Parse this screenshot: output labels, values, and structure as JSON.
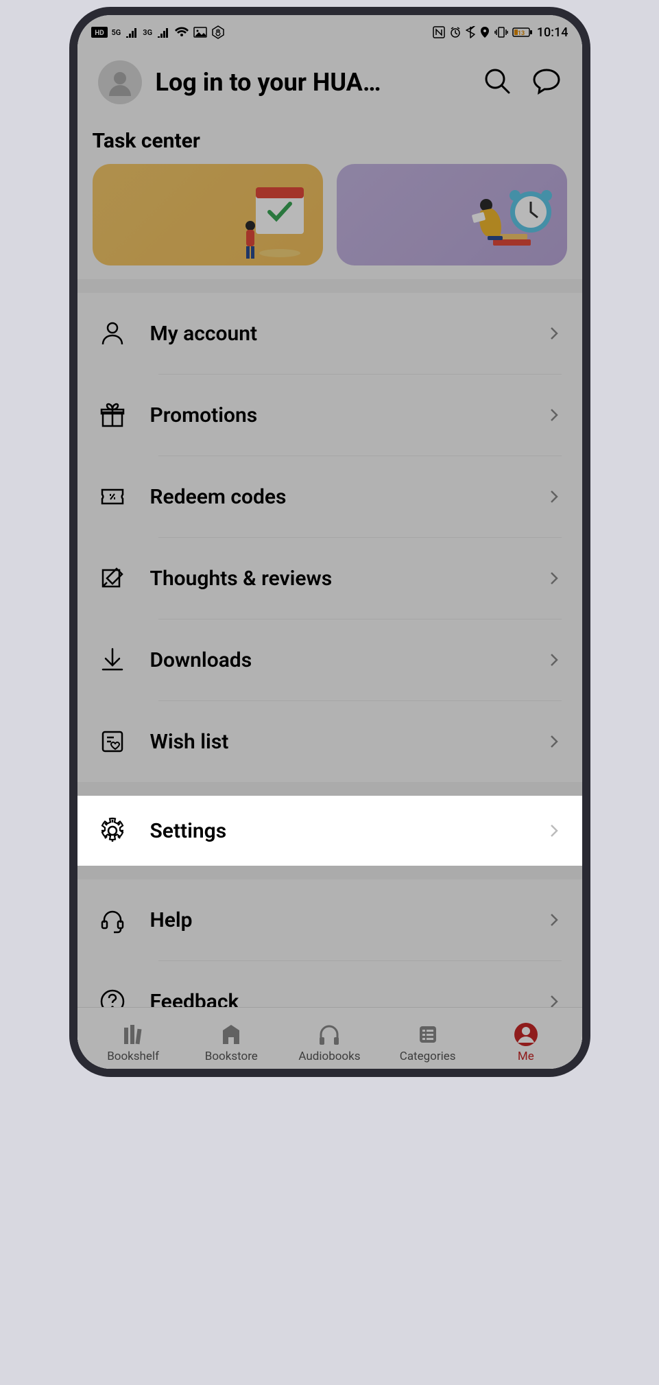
{
  "status": {
    "hd_badge": "HD",
    "net1": "5G",
    "net2": "3G",
    "battery_percent": "13",
    "time": "10:14"
  },
  "header": {
    "title": "Log in to your HUA…"
  },
  "task_center": {
    "title": "Task center"
  },
  "menu": {
    "my_account": "My account",
    "promotions": "Promotions",
    "redeem_codes": "Redeem codes",
    "thoughts_reviews": "Thoughts & reviews",
    "downloads": "Downloads",
    "wish_list": "Wish list",
    "settings": "Settings",
    "help": "Help",
    "feedback": "Feedback"
  },
  "bottom_nav": {
    "bookshelf": "Bookshelf",
    "bookstore": "Bookstore",
    "audiobooks": "Audiobooks",
    "categories": "Categories",
    "me": "Me"
  }
}
